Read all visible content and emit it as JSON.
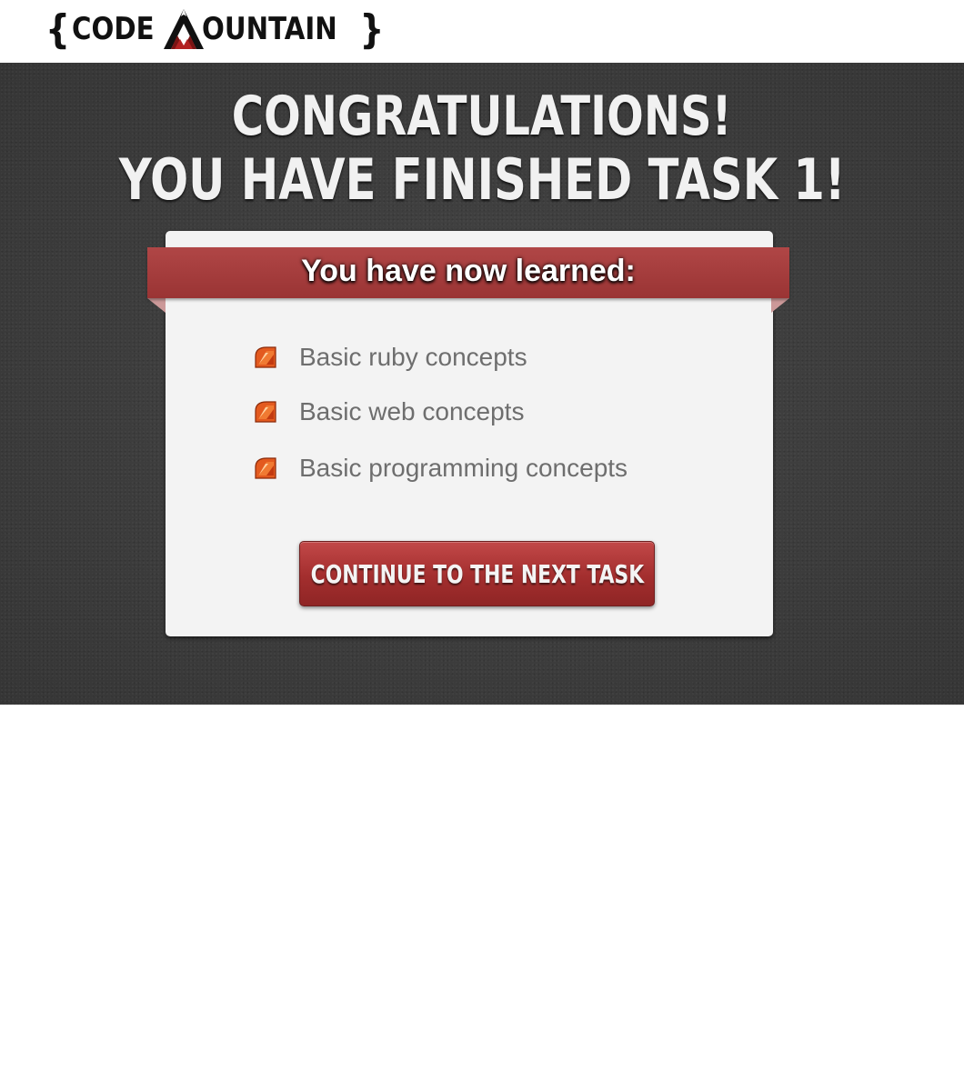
{
  "header": {
    "logo_left": "CODE",
    "logo_right": "OUNTAIN",
    "logo_brace_open": "{",
    "logo_brace_close": "}",
    "logo_icon": "mountain-m-icon"
  },
  "hero": {
    "headline_line1": "CONGRATULATIONS!",
    "headline_line2": "YOU HAVE FINISHED TASK 1!"
  },
  "card": {
    "ribbon_title": "You have now learned:",
    "items": [
      {
        "icon": "ruby-gem-icon",
        "label": "Basic ruby concepts"
      },
      {
        "icon": "ruby-gem-icon",
        "label": "Basic web concepts"
      },
      {
        "icon": "ruby-gem-icon",
        "label": "Basic programming concepts"
      }
    ],
    "cta_label": "CONTINUE TO THE NEXT TASK"
  },
  "colors": {
    "hero_bg": "#3d3d3d",
    "accent_red": "#a83a3a",
    "card_bg": "#f3f3f3",
    "text_gray": "#6e6e6e"
  }
}
